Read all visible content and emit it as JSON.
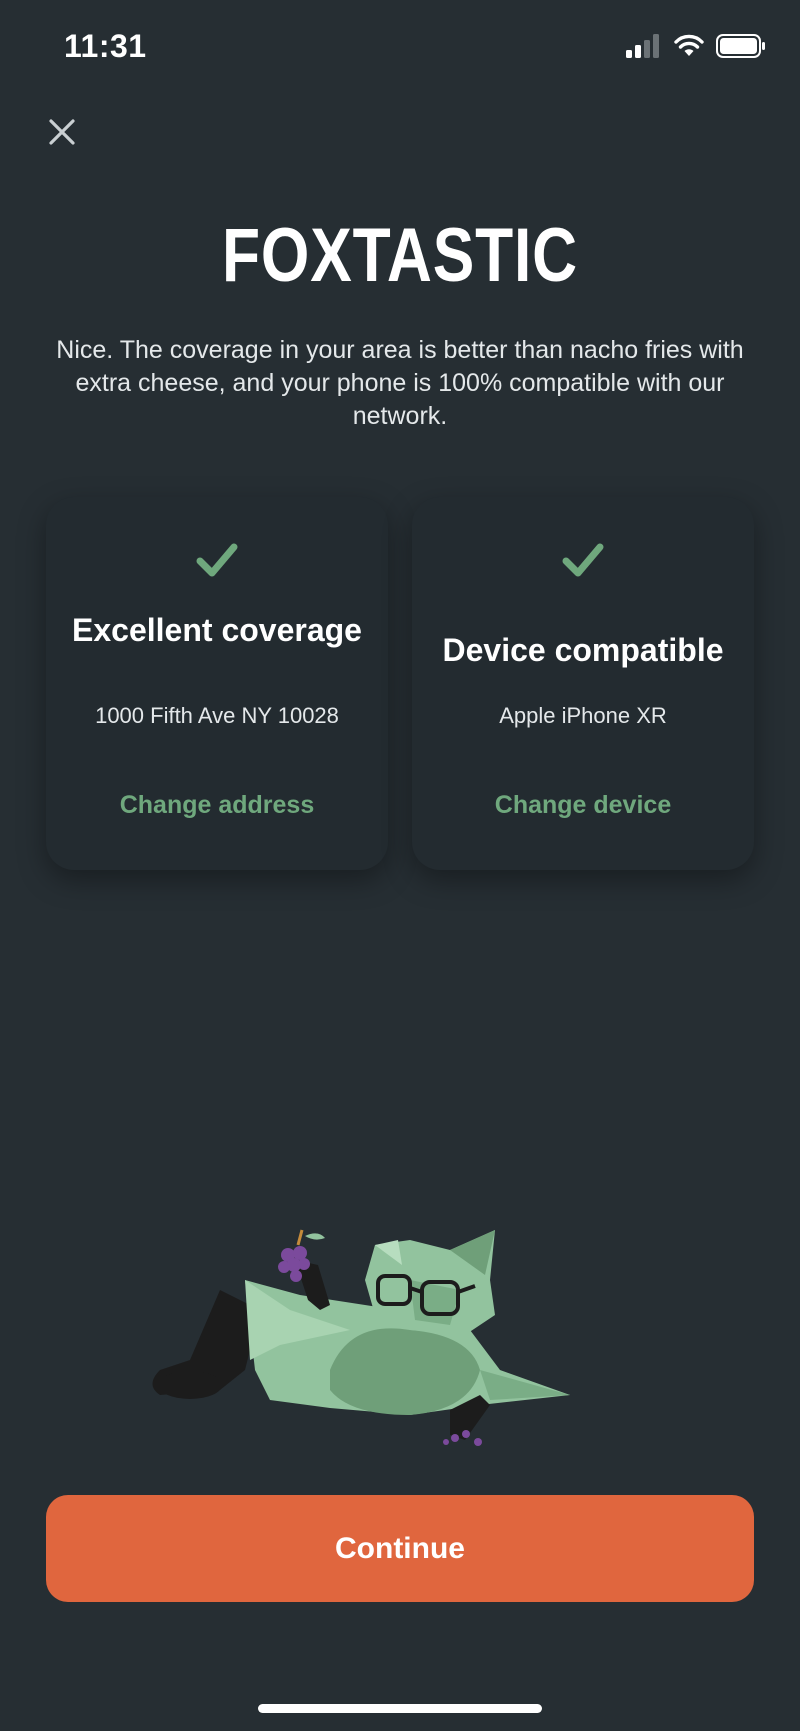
{
  "status_bar": {
    "time": "11:31",
    "icons": [
      "signal-icon",
      "wifi-icon",
      "battery-icon"
    ]
  },
  "header": {
    "close_icon": "close-icon",
    "title": "FOXTASTIC",
    "subtitle": "Nice. The coverage in your area is better than nacho fries with extra cheese, and your phone is 100% compatible with our network."
  },
  "cards": [
    {
      "icon": "check-icon",
      "title": "Excellent coverage",
      "detail": "1000 Fifth Ave NY 10028",
      "link": "Change address"
    },
    {
      "icon": "check-icon",
      "title": "Device compatible",
      "detail": "Apple iPhone XR",
      "link": "Change device"
    }
  ],
  "footer": {
    "continue_label": "Continue"
  },
  "colors": {
    "background": "#262e33",
    "card": "#232b30",
    "accent_green": "#6fa87d",
    "button_orange": "#e0663e"
  }
}
